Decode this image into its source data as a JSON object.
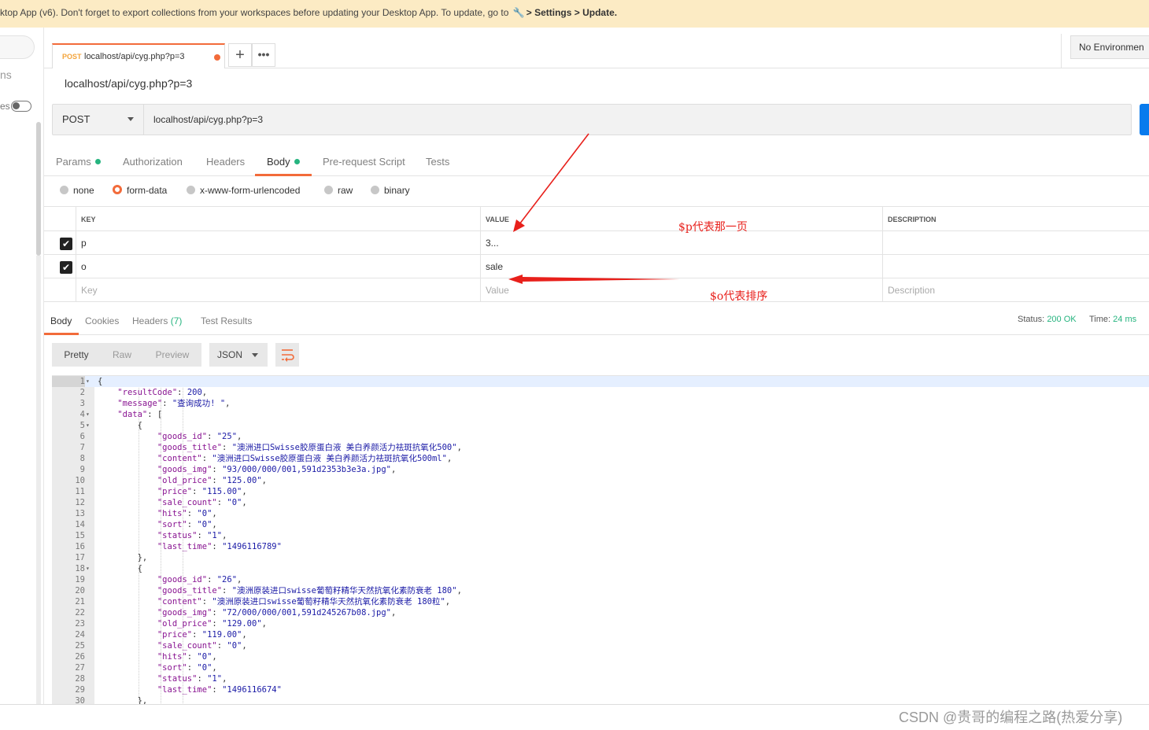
{
  "banner": {
    "text": "ktop App (v6). Don't forget to export collections from your workspaces before updating your Desktop App. To update, go to",
    "settings_path": "> Settings > Update."
  },
  "sidebar": {
    "partial_label": "ns",
    "toggle_label": "es"
  },
  "tab": {
    "method": "POST",
    "url": "localhost/api/cyg.php?p=3"
  },
  "environment": {
    "label": "No Environmen"
  },
  "request": {
    "title": "localhost/api/cyg.php?p=3",
    "method": "POST",
    "url": "localhost/api/cyg.php?p=3"
  },
  "request_tabs": [
    "Params",
    "Authorization",
    "Headers",
    "Body",
    "Pre-request Script",
    "Tests"
  ],
  "body_types": [
    "none",
    "form-data",
    "x-www-form-urlencoded",
    "raw",
    "binary"
  ],
  "kv_table": {
    "headers": [
      "KEY",
      "VALUE",
      "DESCRIPTION"
    ],
    "rows": [
      {
        "key": "p",
        "value": "3...",
        "description": ""
      },
      {
        "key": "o",
        "value": "sale",
        "description": ""
      }
    ],
    "placeholder": {
      "key": "Key",
      "value": "Value",
      "description": "Description"
    }
  },
  "annotations": {
    "p_note": "$p代表那一页",
    "o_note": "$o代表排序"
  },
  "response_tabs": {
    "body": "Body",
    "cookies": "Cookies",
    "headers": "Headers",
    "headers_count": "(7)",
    "tests": "Test Results"
  },
  "response_status": {
    "status_label": "Status:",
    "status_value": "200 OK",
    "time_label": "Time:",
    "time_value": "24 ms"
  },
  "view_modes": [
    "Pretty",
    "Raw",
    "Preview"
  ],
  "format": "JSON",
  "code_lines": [
    {
      "n": "1",
      "f": "▾",
      "t": "{"
    },
    {
      "n": "2",
      "f": "",
      "t": "    \"resultCode\": 200,"
    },
    {
      "n": "3",
      "f": "",
      "t": "    \"message\": \"查询成功! \","
    },
    {
      "n": "4",
      "f": "▾",
      "t": "    \"data\": ["
    },
    {
      "n": "5",
      "f": "▾",
      "t": "        {"
    },
    {
      "n": "6",
      "f": "",
      "t": "            \"goods_id\": \"25\","
    },
    {
      "n": "7",
      "f": "",
      "t": "            \"goods_title\": \"澳洲进口Swisse胶原蛋白液 美白养颜活力祛斑抗氧化500\","
    },
    {
      "n": "8",
      "f": "",
      "t": "            \"content\": \"澳洲进口Swisse胶原蛋白液 美白养颜活力祛斑抗氧化500ml\","
    },
    {
      "n": "9",
      "f": "",
      "t": "            \"goods_img\": \"93/000/000/001,591d2353b3e3a.jpg\","
    },
    {
      "n": "10",
      "f": "",
      "t": "            \"old_price\": \"125.00\","
    },
    {
      "n": "11",
      "f": "",
      "t": "            \"price\": \"115.00\","
    },
    {
      "n": "12",
      "f": "",
      "t": "            \"sale_count\": \"0\","
    },
    {
      "n": "13",
      "f": "",
      "t": "            \"hits\": \"0\","
    },
    {
      "n": "14",
      "f": "",
      "t": "            \"sort\": \"0\","
    },
    {
      "n": "15",
      "f": "",
      "t": "            \"status\": \"1\","
    },
    {
      "n": "16",
      "f": "",
      "t": "            \"last_time\": \"1496116789\""
    },
    {
      "n": "17",
      "f": "",
      "t": "        },"
    },
    {
      "n": "18",
      "f": "▾",
      "t": "        {"
    },
    {
      "n": "19",
      "f": "",
      "t": "            \"goods_id\": \"26\","
    },
    {
      "n": "20",
      "f": "",
      "t": "            \"goods_title\": \"澳洲原装进口swisse葡萄籽精华天然抗氧化素防衰老 180\","
    },
    {
      "n": "21",
      "f": "",
      "t": "            \"content\": \"澳洲原装进口swisse葡萄籽精华天然抗氧化素防衰老 180粒\","
    },
    {
      "n": "22",
      "f": "",
      "t": "            \"goods_img\": \"72/000/000/001,591d245267b08.jpg\","
    },
    {
      "n": "23",
      "f": "",
      "t": "            \"old_price\": \"129.00\","
    },
    {
      "n": "24",
      "f": "",
      "t": "            \"price\": \"119.00\","
    },
    {
      "n": "25",
      "f": "",
      "t": "            \"sale_count\": \"0\","
    },
    {
      "n": "26",
      "f": "",
      "t": "            \"hits\": \"0\","
    },
    {
      "n": "27",
      "f": "",
      "t": "            \"sort\": \"0\","
    },
    {
      "n": "28",
      "f": "",
      "t": "            \"status\": \"1\","
    },
    {
      "n": "29",
      "f": "",
      "t": "            \"last_time\": \"1496116674\""
    },
    {
      "n": "30",
      "f": "",
      "t": "        },"
    }
  ],
  "watermark": "CSDN @贵哥的编程之路(热爱分享)",
  "colors": {
    "accent": "#f26b3a",
    "success": "#26b47f",
    "send": "#097bed",
    "annotation": "#e8201b",
    "banner": "#fcebc4"
  }
}
